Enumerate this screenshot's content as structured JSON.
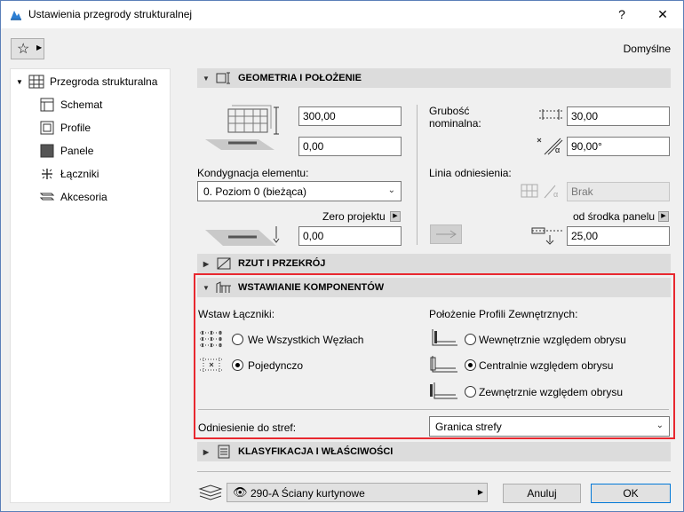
{
  "window": {
    "title": "Ustawienia przegrody strukturalnej",
    "help": "?",
    "close": "✕"
  },
  "toolbar": {
    "star": "☆",
    "defaults": "Domyślne"
  },
  "sidebar": {
    "items": [
      {
        "label": "Przegroda strukturalna",
        "icon": "curtain-wall-icon"
      },
      {
        "label": "Schemat",
        "icon": "scheme-icon"
      },
      {
        "label": "Profile",
        "icon": "profile-icon"
      },
      {
        "label": "Panele",
        "icon": "panel-icon"
      },
      {
        "label": "Łączniki",
        "icon": "junction-icon"
      },
      {
        "label": "Akcesoria",
        "icon": "accessory-icon"
      }
    ]
  },
  "geometry": {
    "title": "GEOMETRIA I POŁOŻENIE",
    "height_value": "300,00",
    "offset_value": "0,00",
    "story_label": "Kondygnacja elementu:",
    "story_value": "0. Poziom 0 (bieżąca)",
    "zero_label": "Zero projektu",
    "zero_value": "0,00",
    "thickness_label_1": "Grubość",
    "thickness_label_2": "nominalna:",
    "thickness_value": "30,00",
    "angle_value": "90,00°",
    "ref_line_label": "Linia odniesienia:",
    "ref_line_value": "Brak",
    "panel_center_label": "od środka panelu",
    "panel_value": "25,00"
  },
  "plan": {
    "title": "RZUT I PRZEKRÓJ"
  },
  "components": {
    "title": "WSTAWIANIE KOMPONENTÓW",
    "junctions_label": "Wstaw Łączniki:",
    "opt_all": "We Wszystkich Węzłach",
    "opt_single": "Pojedynczo",
    "boundary_label": "Położenie Profili Zewnętrznych:",
    "opt_inside": "Wewnętrznie względem obrysu",
    "opt_center": "Centralnie względem obrysu",
    "opt_outside": "Zewnętrznie względem obrysu",
    "zone_label": "Odniesienie do stref:",
    "zone_value": "Granica strefy"
  },
  "classification": {
    "title": "KLASYFIKACJA I WŁAŚCIWOŚCI"
  },
  "footer": {
    "layer": "290-A Ściany kurtynowe",
    "cancel": "Anuluj",
    "ok": "OK"
  }
}
